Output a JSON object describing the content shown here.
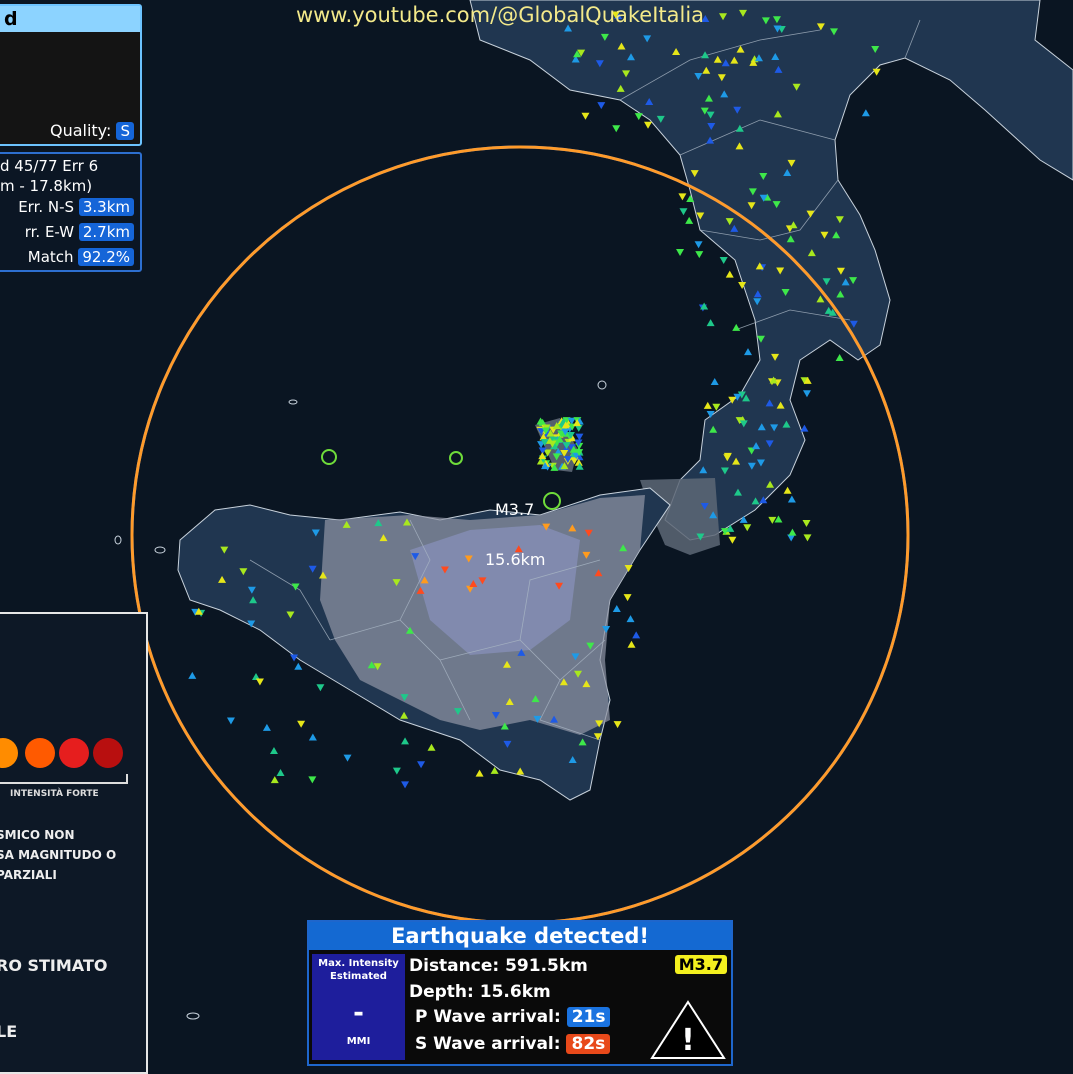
{
  "watermark": "www.youtube.com/@GlobalQuakeItalia",
  "top_panel": {
    "title": "d",
    "quality_label": "Quality:",
    "quality_value": "S"
  },
  "location_panel": {
    "line1": "d 45/77 Err 6",
    "line2": "m - 17.8km)",
    "err_ns_label": "Err. N-S",
    "err_ns_value": "3.3km",
    "err_ew_label": "rr. E-W",
    "err_ew_value": "2.7km",
    "match_label": "Match",
    "match_value": "92.2%"
  },
  "legend_panel": {
    "intensity_label": "INTENSITÀ FORTE",
    "note_line1": "SMICO NON",
    "note_line2": "SA MAGNITUDO O",
    "note_line3": "PARZIALI",
    "epicenter_label": "RO STIMATO",
    "bottom_label": "LE",
    "dot_colors": [
      "#ff8c00",
      "#ff5a00",
      "#e61e1e",
      "#b80f0f"
    ]
  },
  "map": {
    "magnitude_label": "M3.7",
    "depth_label": "15.6km",
    "wave_circle_color": "#ff9b2a"
  },
  "alert": {
    "title": "Earthquake detected!",
    "intensity_label_1": "Max. Intensity",
    "intensity_label_2": "Estimated",
    "intensity_value": "-",
    "intensity_unit": "MMI",
    "distance_label": "Distance:",
    "distance_value": "591.5km",
    "depth_label": "Depth:",
    "depth_value": "15.6km",
    "p_label": "P Wave arrival:",
    "p_value": "21s",
    "s_label": "S Wave arrival:",
    "s_value": "82s",
    "magnitude": "M3.7",
    "warning_symbol": "!"
  },
  "colors": {
    "p_badge": "#1a73e0",
    "s_badge": "#e8491a",
    "accent": "#1469d2"
  }
}
